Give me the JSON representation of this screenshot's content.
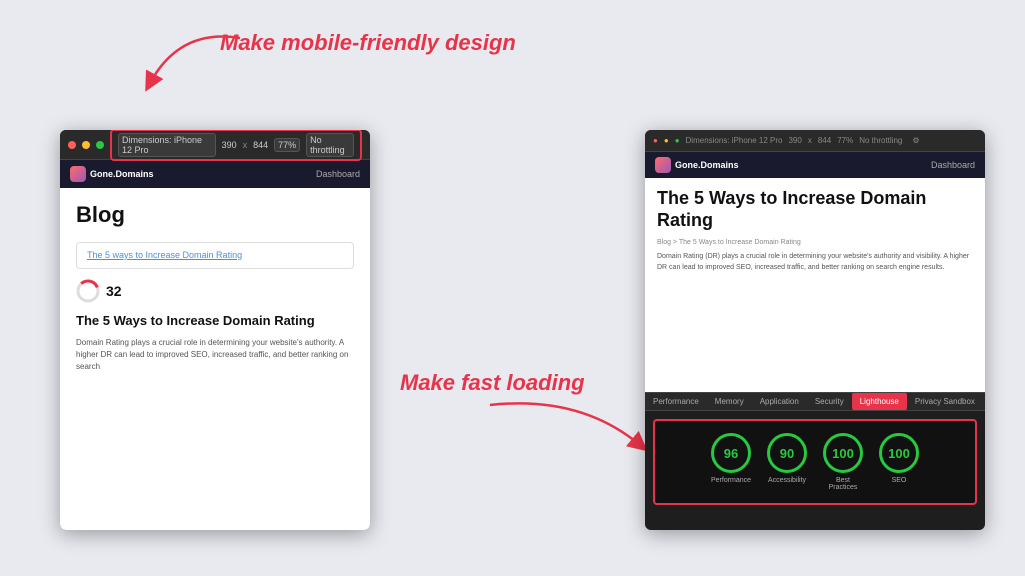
{
  "annotations": {
    "top": "Make mobile-friendly design",
    "bottom": "Make fast loading"
  },
  "left_browser": {
    "toolbar": {
      "device": "Dimensions: iPhone 12 Pro",
      "width": "390",
      "x": "x",
      "height": "844",
      "zoom": "77%",
      "throttle": "No throttling"
    },
    "page": {
      "logo": "Gone.Domains",
      "nav": "Dashboard",
      "blog_title": "Blog",
      "link_card": "The 5 ways to Increase Domain Rating",
      "score": "32",
      "article_title": "The 5 Ways to Increase Domain Rating",
      "article_body": "Domain Rating plays a crucial role in determining your website's authority. A higher DR can lead to improved SEO, increased traffic, and better ranking on search"
    }
  },
  "right_browser": {
    "toolbar": {
      "device": "Dimensions: iPhone 12 Pro",
      "width": "390",
      "x": "x",
      "height": "844",
      "zoom": "77%",
      "throttle": "No throttling"
    },
    "page": {
      "logo": "Gone.Domains",
      "nav": "Dashboard",
      "article_title": "The 5 Ways to Increase Domain Rating",
      "breadcrumb": "Blog > The 5 Ways to Increase Domain Rating",
      "article_body": "Domain Rating (DR) plays a crucial role in determining your website's authority and visibility. A higher DR can lead to improved SEO, increased traffic, and better ranking on search engine results."
    },
    "devtools": {
      "tabs": [
        "Performance",
        "Memory",
        "Application",
        "Security",
        "Lighthouse",
        "Privacy Sandbox"
      ],
      "active_tab": "Lighthouse",
      "scores": [
        {
          "value": "96",
          "label": "Performance"
        },
        {
          "value": "90",
          "label": "Accessibility"
        },
        {
          "value": "100",
          "label": "Best Practices"
        },
        {
          "value": "100",
          "label": "SEO"
        }
      ]
    }
  }
}
